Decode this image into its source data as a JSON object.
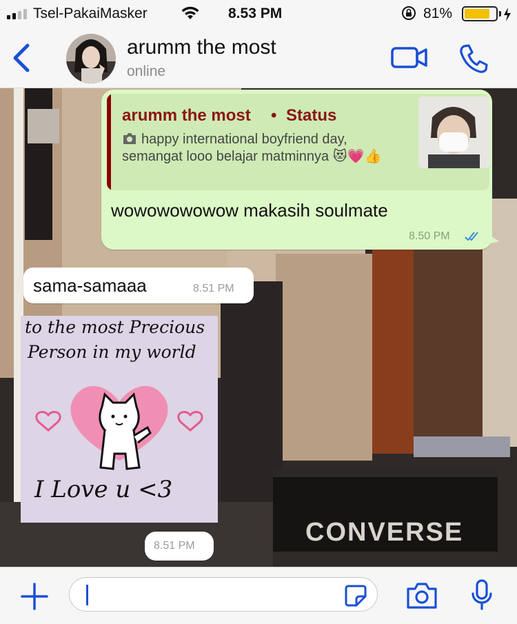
{
  "status_bar": {
    "carrier": "Tsel-PakaiMasker",
    "time": "8.53 PM",
    "battery_percent": "81%",
    "battery_level": 0.81,
    "battery_color": "#f2c200"
  },
  "header": {
    "back_icon": "chevron-left-icon",
    "contact_name": "arumm the most",
    "contact_status": "online",
    "video_icon": "video-camera-icon",
    "call_icon": "phone-icon",
    "accent_color": "#1a4fd6"
  },
  "messages": {
    "outgoing": {
      "quote": {
        "author": "arumm the most",
        "separator": "•",
        "label": "Status",
        "text": "happy international boyfriend day, semangat looo belajar matminnya 😻💗👍"
      },
      "text": "wowowowowow makasih soulmate",
      "time": "8.50 PM",
      "status_icon": "double-check-icon"
    },
    "incoming": {
      "text": "sama-samaaa",
      "time": "8.51 PM"
    },
    "sticker": {
      "line1": "to the most Precious",
      "line2": "Person in my world",
      "line3": "I Love u <3",
      "time": "8.51 PM"
    }
  },
  "input_bar": {
    "plus_icon": "plus-icon",
    "sticker_icon": "sticker-icon",
    "camera_icon": "camera-icon",
    "mic_icon": "microphone-icon",
    "value": ""
  }
}
